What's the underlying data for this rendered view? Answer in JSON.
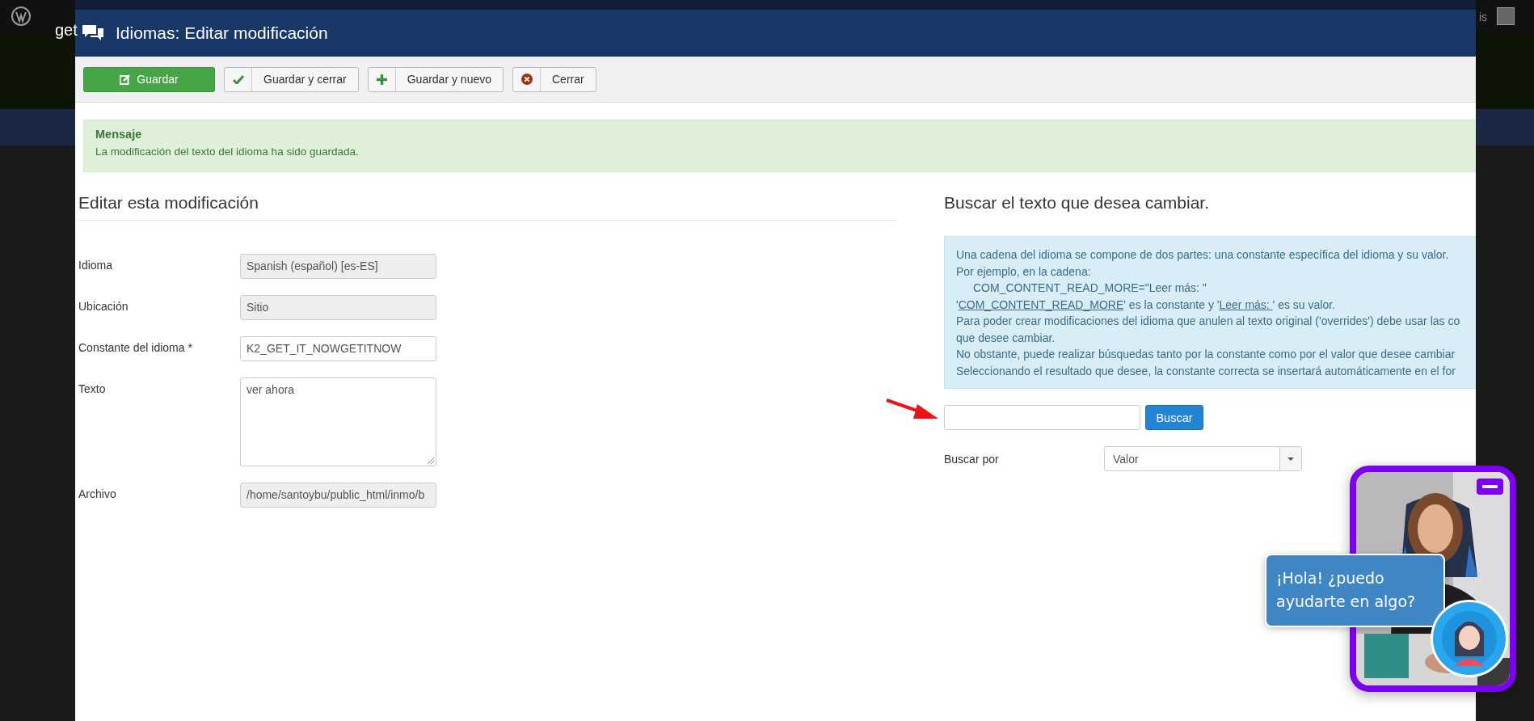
{
  "backdrop": {
    "left_text": "get",
    "right_text": "is"
  },
  "window": {
    "title": "Idiomas: Editar modificación"
  },
  "toolbar": [
    {
      "label": "Guardar",
      "kind": "primary"
    },
    {
      "label": "Guardar y cerrar",
      "kind": "check"
    },
    {
      "label": "Guardar y nuevo",
      "kind": "plus"
    },
    {
      "label": "Cerrar",
      "kind": "close"
    }
  ],
  "message": {
    "title": "Mensaje",
    "text": "La modificación del texto del idioma ha sido guardada."
  },
  "edit_form": {
    "heading": "Editar esta modificación",
    "fields": [
      {
        "label": "Idioma",
        "value": "Spanish (español) [es-ES]",
        "kind": "readonly"
      },
      {
        "label": "Ubicación",
        "value": "Sitio",
        "kind": "readonly"
      },
      {
        "label": "Constante del idioma *",
        "value": "K2_GET_IT_NOWGETITNOW",
        "kind": "input"
      },
      {
        "label": "Texto",
        "value": "ver ahora",
        "kind": "textarea"
      },
      {
        "label": "Archivo",
        "value": "/home/santoybu/public_html/inmo/b",
        "kind": "readonly"
      }
    ]
  },
  "search_panel": {
    "heading": "Buscar el texto que desea cambiar.",
    "info_lines": [
      {
        "kind": "plain",
        "text": "Una cadena del idioma se compone de dos partes: una constante específica del idioma y su valor."
      },
      {
        "kind": "plain",
        "text": "Por ejemplo, en la cadena:"
      },
      {
        "kind": "code",
        "text": "COM_CONTENT_READ_MORE=\"Leer más: \""
      },
      {
        "kind": "mixed",
        "parts": [
          {
            "text": "'",
            "kind": "text"
          },
          {
            "text": "COM_CONTENT_READ_MORE",
            "kind": "link"
          },
          {
            "text": "' es la constante y '",
            "kind": "text"
          },
          {
            "text": "Leer más: ",
            "kind": "link"
          },
          {
            "text": "' es su valor.",
            "kind": "text"
          }
        ]
      },
      {
        "kind": "plain",
        "text": "Para poder crear modificaciones del idioma que anulen al texto original ('overrides') debe usar las co"
      },
      {
        "kind": "plain",
        "text": "que desee cambiar."
      },
      {
        "kind": "plain",
        "text": "No obstante, puede realizar búsquedas tanto por la constante como por el valor que desee cambiar"
      },
      {
        "kind": "plain",
        "text": "Seleccionando el resultado que desee, la constante correcta se insertará automáticamente en el for"
      }
    ],
    "button": "Buscar",
    "search_by_label": "Buscar por",
    "search_by_value": "Valor"
  },
  "chat": {
    "greeting": "¡Hola! ¿puedo ayudarte en algo?"
  }
}
